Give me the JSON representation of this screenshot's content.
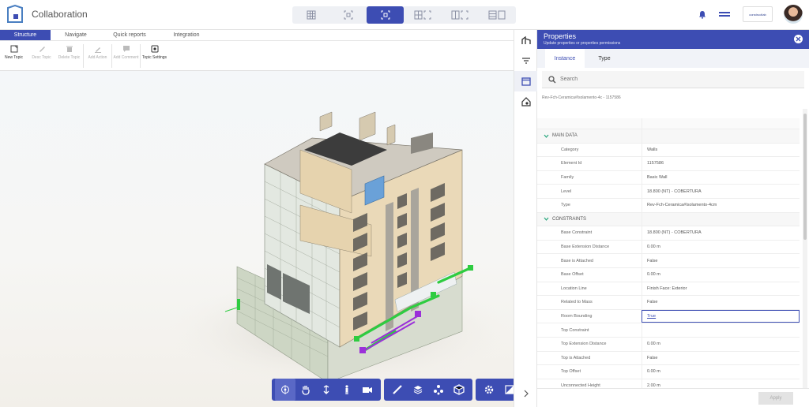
{
  "app": {
    "title": "Collaboration"
  },
  "topbar": {
    "brand_chip": "constructlab"
  },
  "tabs": [
    {
      "label": "Structure"
    },
    {
      "label": "Navigate"
    },
    {
      "label": "Quick reports"
    },
    {
      "label": "Integration"
    }
  ],
  "ribbon": [
    {
      "label": "New Topic",
      "icon": "new-topic-icon",
      "enabled": true
    },
    {
      "label": "Desc Topic",
      "icon": "edit-icon",
      "enabled": false
    },
    {
      "label": "Delete Topic",
      "icon": "trash-icon",
      "enabled": false
    },
    {
      "label": "Add Action",
      "icon": "pen-icon",
      "enabled": false
    },
    {
      "label": "Add Comment",
      "icon": "comment-icon",
      "enabled": false
    },
    {
      "label": "Topic Settings",
      "icon": "settings-icon",
      "enabled": true
    }
  ],
  "properties": {
    "title": "Properties",
    "subtitle": "Update properties or properties permissions",
    "tabs": [
      "Instance",
      "Type"
    ],
    "search_placeholder": "Search",
    "element_name": "Rev-Fch-Ceramica#Isolamento-4c - 1157586",
    "sections": [
      {
        "name": "MAIN DATA",
        "rows": [
          {
            "key": "Category",
            "value": "Walls"
          },
          {
            "key": "Element Id",
            "value": "1157586"
          },
          {
            "key": "Family",
            "value": "Basic Wall"
          },
          {
            "key": "Level",
            "value": "18.800 (NT) - COBERTURA"
          },
          {
            "key": "Type",
            "value": "Rev-Fch-Ceramica#Isolamento-4cm"
          }
        ]
      },
      {
        "name": "CONSTRAINTS",
        "rows": [
          {
            "key": "Base Constraint",
            "value": "18.800 (NT) - COBERTURA"
          },
          {
            "key": "Base Extension Distance",
            "value": "0.00 m"
          },
          {
            "key": "Base is Attached",
            "value": "False"
          },
          {
            "key": "Base Offset",
            "value": "0.00 m"
          },
          {
            "key": "Location Line",
            "value": "Finish Face: Exterior"
          },
          {
            "key": "Related to Mass",
            "value": "False"
          },
          {
            "key": "Room Bounding",
            "value": "True"
          },
          {
            "key": "Top Constraint",
            "value": ""
          },
          {
            "key": "Top Extension Distance",
            "value": "0.00 m"
          },
          {
            "key": "Top is Attached",
            "value": "False"
          },
          {
            "key": "Top Offset",
            "value": "0.00 m"
          },
          {
            "key": "Unconnected Height",
            "value": "2.00 m"
          }
        ]
      }
    ],
    "apply_label": "Apply"
  },
  "colors": {
    "accent": "#3d4db3",
    "selection_green": "#2ecc40",
    "selection_purple": "#9b30d9"
  }
}
